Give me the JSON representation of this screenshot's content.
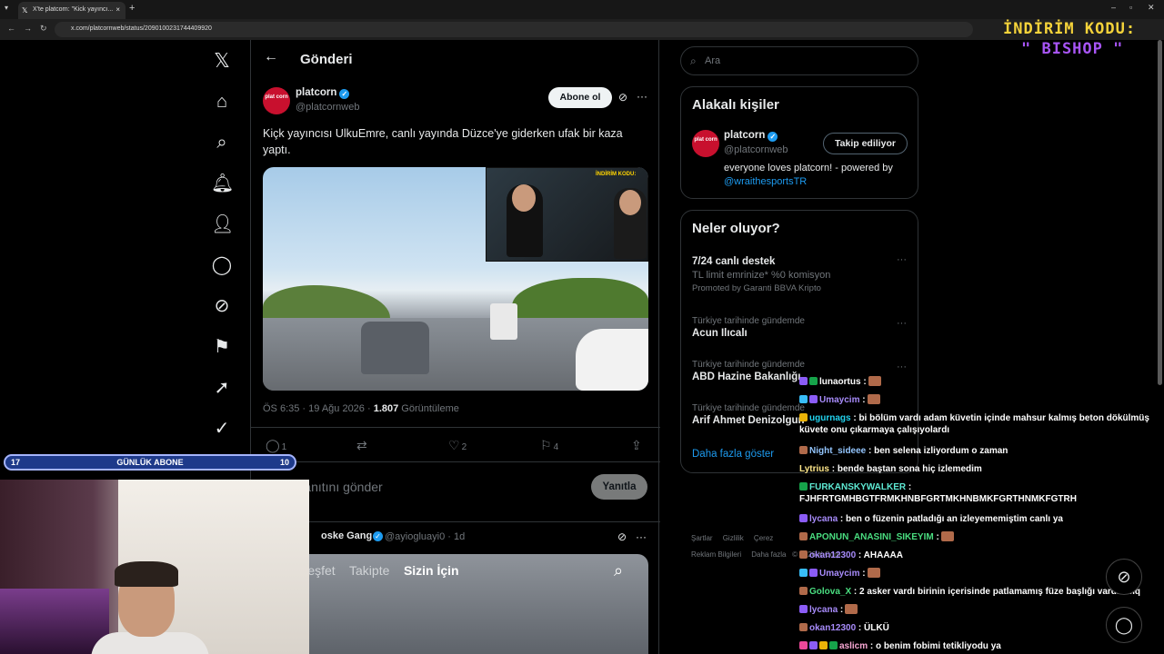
{
  "browser": {
    "tab_title": "X'te platcorn: \"Kick yayıncı...",
    "url": "x.com/platcornweb/status/2090100231744409920",
    "new_tab": "+",
    "tab_close": "×"
  },
  "overlay": {
    "promo_line1": "İNDİRİM KODU:",
    "promo_line2": "\" BISHOP \"",
    "sub_left": "17",
    "sub_label": "GÜNLÜK ABONE",
    "sub_right": "10"
  },
  "header": {
    "title": "Gönderi"
  },
  "tweet": {
    "avatar_text": "plat corn",
    "name": "platcorn",
    "handle": "@platcornweb",
    "follow_label": "Abone ol",
    "text": "Kiçk yayıncısı UlkuEmre, canlı yayında Düzce'ye giderken ufak bir kaza yaptı.",
    "media_tag": "İNDİRİM KODU:",
    "time": "ÖS 6:35 · 19 Ağu 2026 · ",
    "views": "1.807",
    "views_label": " Görüntüleme",
    "replies": "1",
    "likes": "2",
    "bookmarks": "4"
  },
  "reply": {
    "placeholder": "Yanıtını gönder",
    "button": "Yanıtla"
  },
  "tweet2": {
    "name": "oske Gang",
    "handle": "@ayiogluayi0 · 1d",
    "tabs": [
      "Keşfet",
      "Takipte",
      "Sizin İçin"
    ]
  },
  "sidebar": {
    "search_placeholder": "Ara",
    "people_title": "Alakalı kişiler",
    "person_name": "platcorn",
    "person_handle": "@platcornweb",
    "person_button": "Takip ediliyor",
    "person_bio": "everyone loves platcorn! - powered by ",
    "person_bio_link": "@wraithesportsTR",
    "trends_title": "Neler oluyor?",
    "trends": [
      {
        "small": "",
        "big": "7/24 canlı destek",
        "sub": "TL limit emrinize* %0 komisyon",
        "promo": "Promoted by Garanti BBVA Kripto"
      },
      {
        "small": "Türkiye tarihinde gündemde",
        "big": "Acun Ilıcalı"
      },
      {
        "small": "Türkiye tarihinde gündemde",
        "big": "ABD Hazine Bakanlığı"
      },
      {
        "small": "Türkiye tarihinde gündemde",
        "big": "Arif Ahmet Denizolgun"
      }
    ],
    "show_more": "Daha fazla göster",
    "footer": [
      "Şartlar",
      "Gizlilik",
      "Çerez",
      "Reklam Bilgileri",
      "Daha fazla",
      "© 2026 X Corp."
    ]
  },
  "chat": [
    {
      "user": "lunaortus",
      "color": "#ffffff",
      "text": " :"
    },
    {
      "user": "Umaycim",
      "color": "#a78bfa",
      "text": " :"
    },
    {
      "user": "ugurnags",
      "color": "#22d3ee",
      "text": " : bi bölüm vardı adam küvetin içinde mahsur kalmış beton dökülmüş küvete onu çıkarmaya çalışıyolardı"
    },
    {
      "user": "Night_sideee",
      "color": "#93c5fd",
      "text": " : ben selena izliyordum o zaman"
    },
    {
      "user": "Lytrius",
      "color": "#fde68a",
      "text": " : bende baştan sona hiç izlemedim"
    },
    {
      "user": "FURKANSKYWALKER",
      "color": "#5eead4",
      "text": " : FJHFRTGMHBGTFRMKHNBFGRTMKHNBMKFGRTHNMKFGTRH"
    },
    {
      "user": "lycana",
      "color": "#a78bfa",
      "text": " : ben o füzenin patladığı an izleyememiştim canlı ya"
    },
    {
      "user": "APONUN_ANASINI_SIKEYIM",
      "color": "#4ade80",
      "text": " :"
    },
    {
      "user": "okan12300",
      "color": "#a78bfa",
      "text": " : AHAAAA"
    },
    {
      "user": "Umaycim",
      "color": "#a78bfa",
      "text": " :"
    },
    {
      "user": "Golova_X",
      "color": "#4ade80",
      "text": " : 2 asker vardı birinin içerisinde patlamamış füze başlığı vardı amq"
    },
    {
      "user": "lycana",
      "color": "#a78bfa",
      "text": " :"
    },
    {
      "user": "okan12300",
      "color": "#a78bfa",
      "text": " : ÜLKÜ"
    },
    {
      "user": "aslicm",
      "color": "#f9a8d4",
      "text": " : o benim fobimi tetikliyodu ya"
    }
  ],
  "colors": {
    "accent": "#1d9bf0",
    "background": "#000000",
    "border": "#2f3336",
    "muted": "#71767b"
  }
}
